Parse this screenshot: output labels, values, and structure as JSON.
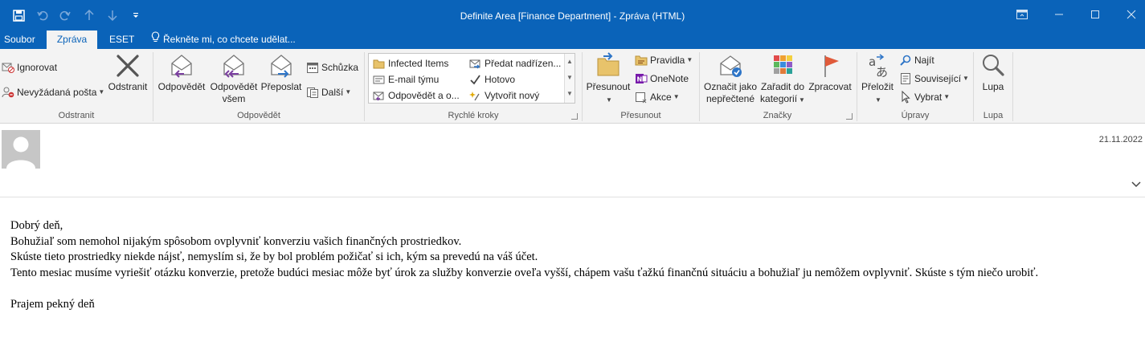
{
  "titlebar": {
    "title": "Definite Area [Finance Department] - Zpráva (HTML)",
    "accent_color": "#0a63b9",
    "quick_access": [
      "save-icon",
      "undo-icon",
      "redo-icon",
      "up-arrow-icon",
      "down-arrow-icon",
      "customize-icon"
    ]
  },
  "tabs": [
    {
      "label": "Soubor",
      "active": false
    },
    {
      "label": "Zpráva",
      "active": true
    },
    {
      "label": "ESET",
      "active": false
    }
  ],
  "tell_me": "Řekněte mi, co chcete udělat...",
  "ribbon": {
    "delete_group": {
      "label": "Odstranit",
      "ignore": "Ignorovat",
      "junk": "Nevyžádaná pošta",
      "delete": "Odstranit"
    },
    "respond_group": {
      "label": "Odpovědět",
      "reply": "Odpovědět",
      "reply_all_1": "Odpovědět",
      "reply_all_2": "všem",
      "forward": "Přeposlat",
      "meeting": "Schůzka",
      "more": "Další"
    },
    "quicksteps_group": {
      "label": "Rychlé kroky",
      "items": [
        "Infected Items",
        "E-mail týmu",
        "Odpovědět a o...",
        "Předat nadřízen...",
        "Hotovo",
        "Vytvořit nový"
      ]
    },
    "move_group": {
      "label": "Přesunout",
      "move": "Přesunout",
      "rules": "Pravidla",
      "onenote": "OneNote",
      "actions": "Akce"
    },
    "tags_group": {
      "label": "Značky",
      "mark_unread_1": "Označit jako",
      "mark_unread_2": "nepřečtené",
      "categorize_1": "Zařadit do",
      "categorize_2": "kategorií",
      "followup": "Zpracovat"
    },
    "editing_group": {
      "label": "Úpravy",
      "translate": "Přeložit",
      "find": "Najít",
      "related": "Související",
      "select": "Vybrat"
    },
    "zoom_group": {
      "label": "Lupa",
      "zoom": "Lupa"
    }
  },
  "message": {
    "date": "21.11.2022",
    "body": [
      "Dobrý deň,",
      "Bohužiaľ som nemohol nijakým spôsobom ovplyvniť konverziu vašich finančných prostriedkov.",
      "Skúste tieto prostriedky niekde nájsť, nemyslím si, že by bol problém požičať si ich, kým sa prevedú na váš účet.",
      "Tento mesiac musíme vyriešiť otázku konverzie, pretože budúci mesiac môže byť úrok za služby konverzie oveľa vyšší, chápem vašu ťažkú finančnú situáciu a bohužiaľ ju nemôžem ovplyvniť. Skúste s tým niečo urobiť."
    ],
    "closing": "Prajem pekný deň"
  }
}
